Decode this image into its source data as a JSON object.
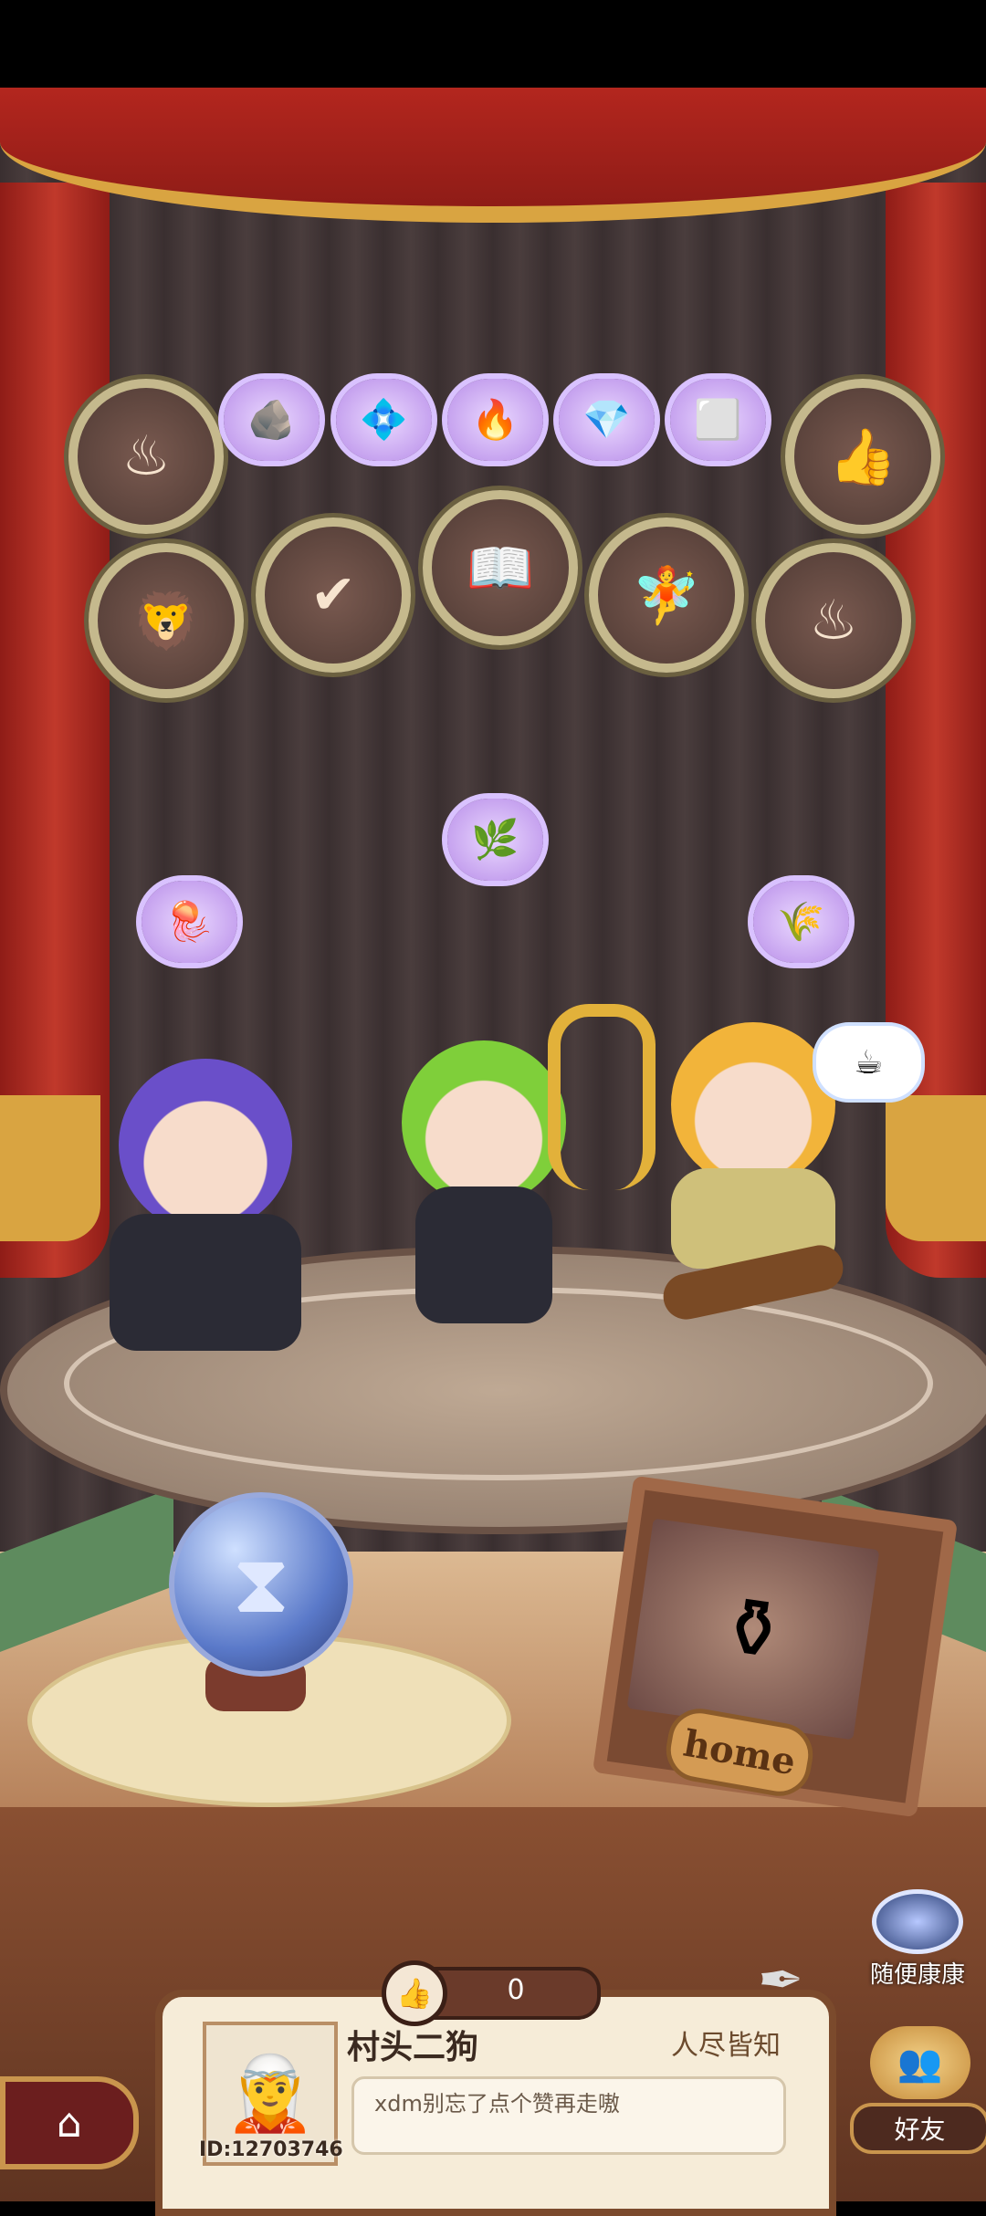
{
  "medals_row1": [
    {
      "icon": "cauldron-icon",
      "glyph": "♨"
    },
    {
      "icon": "thumb-flower-icon",
      "glyph": "👍"
    }
  ],
  "items_row": [
    {
      "icon": "ore-pile-icon",
      "glyph": "🪨"
    },
    {
      "icon": "gem-plate-icon",
      "glyph": "💠"
    },
    {
      "icon": "fire-ore-icon",
      "glyph": "🔥"
    },
    {
      "icon": "blue-crystal-icon",
      "glyph": "💎"
    },
    {
      "icon": "white-stone-icon",
      "glyph": "⬜"
    }
  ],
  "medals_row2": [
    {
      "icon": "lion-face-icon",
      "glyph": "🦁"
    },
    {
      "icon": "scroll-check-icon",
      "glyph": "✔"
    },
    {
      "icon": "book-icon",
      "glyph": "📖"
    },
    {
      "icon": "fairy-icon",
      "glyph": "🧚"
    },
    {
      "icon": "cauldron-icon",
      "glyph": "♨"
    }
  ],
  "floating_items": [
    {
      "icon": "herb-icon",
      "glyph": "🌿"
    },
    {
      "icon": "jellyfish-icon",
      "glyph": "🪼"
    },
    {
      "icon": "golden-wheat-icon",
      "glyph": "🌾"
    }
  ],
  "thought_bubble_icon": "teacup-icon",
  "frame_label": "home",
  "random_button": {
    "label": "随便康康"
  },
  "likes": {
    "count": "0"
  },
  "profile": {
    "nickname": "村头二狗",
    "title": "人尽皆知",
    "motto": "xdm别忘了点个赞再走嗷",
    "uid": "ID:12703746"
  },
  "friends_button": {
    "label": "好友"
  },
  "colors": {
    "curtain": "#b3261e",
    "fringe": "#d9a441",
    "panel": "#f6ecd8",
    "panel_border": "#7b4a2c"
  }
}
